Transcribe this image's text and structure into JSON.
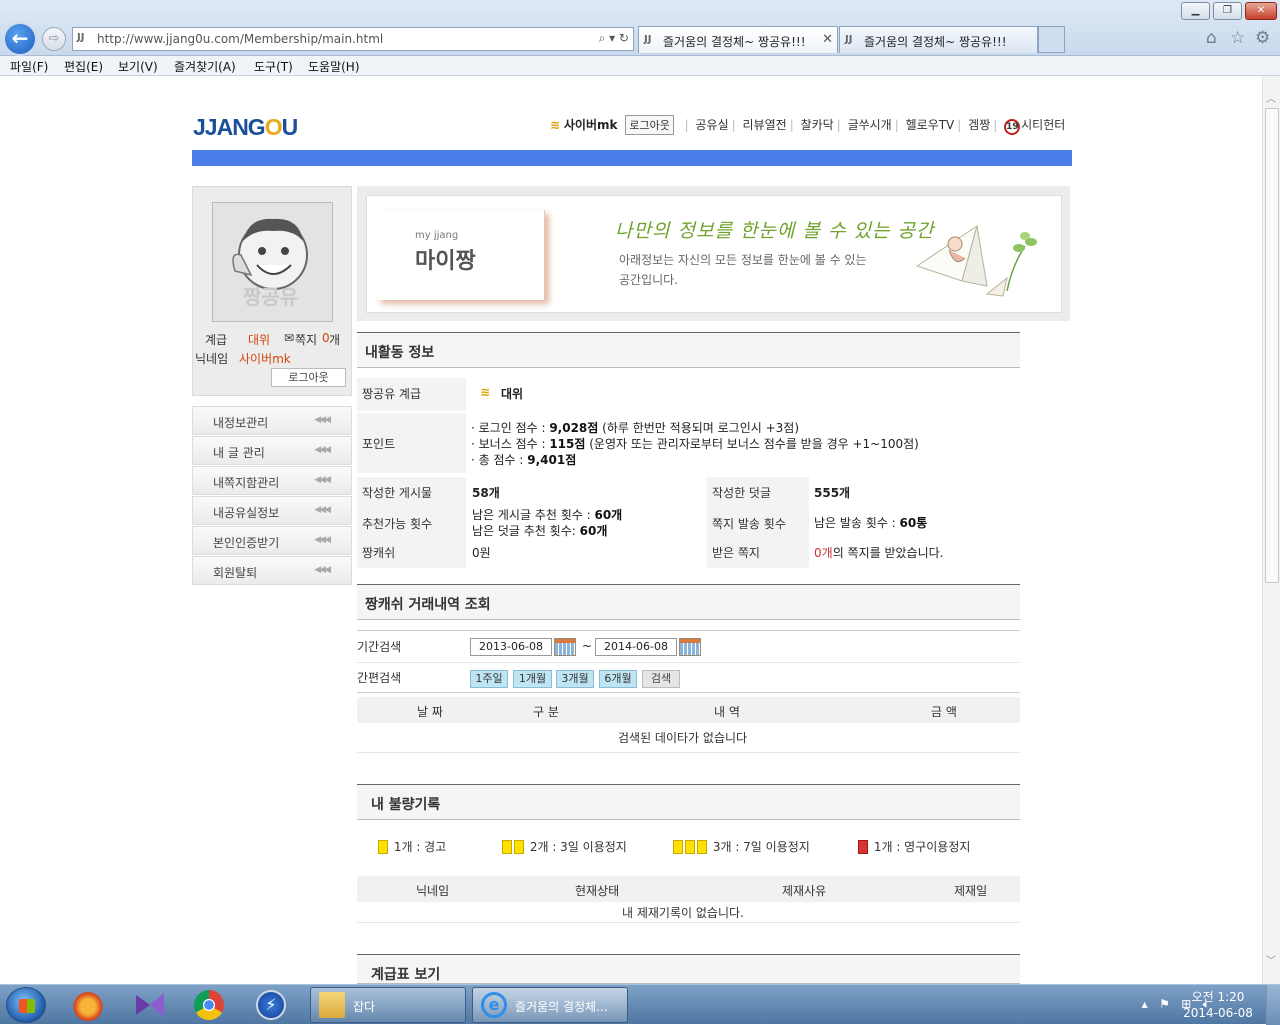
{
  "browser": {
    "address_url": "http://www.jjang0u.com/Membership/main.html",
    "tabs": [
      {
        "label": "즐거움의 결정체~ 짱공유!!!",
        "active": true
      },
      {
        "label": "즐거움의 결정체~ 짱공유!!!",
        "active": false
      }
    ],
    "menu": [
      "파일(F)",
      "편집(E)",
      "보기(V)",
      "즐겨찾기(A)",
      "도구(T)",
      "도움말(H)"
    ]
  },
  "header": {
    "logo_prefix": "JJANG",
    "logo_o": "O",
    "logo_suffix": "U",
    "username": "사이버mk",
    "logout": "로그아웃",
    "nav": [
      "공유실",
      "리뷰열전",
      "찰카닥",
      "글쑤시개",
      "헬로우TV",
      "겜짱"
    ],
    "age_badge": "19",
    "age_link": "시티헌터"
  },
  "profile": {
    "avatar_caption": "짱공유",
    "rank_label": "계급",
    "rank_value": "대위",
    "note_label": "쪽지",
    "note_count": "0",
    "note_unit": "개",
    "nickname_label": "닉네임",
    "nickname_value": "사이버mk",
    "logout": "로그아웃"
  },
  "sidebar": {
    "items": [
      {
        "label": "내정보관리"
      },
      {
        "label": "내 글 관리"
      },
      {
        "label": "내쪽지함관리"
      },
      {
        "label": "내공유실정보"
      },
      {
        "label": "본인인증받기"
      },
      {
        "label": "회원탈퇴"
      }
    ],
    "arrow": "◀◀◀"
  },
  "banner": {
    "small": "my jjang",
    "title": "마이짱",
    "slogan": "나만의 정보를 한눈에 볼 수 있는 공간",
    "desc": "아래정보는 자신의 모든 정보를 한눈에 볼 수 있는 공간입니다."
  },
  "activity": {
    "heading": "내활동 정보",
    "grade_label": "짱공유 계급",
    "grade_value": "대위",
    "points_label": "포인트",
    "login_prefix": "· 로그인 점수 : ",
    "login_score": "9,028점",
    "login_note": " (하루 한번만 적용되며 로그인시 +3점)",
    "bonus_prefix": "· 보너스 점수 : ",
    "bonus_score": "115점",
    "bonus_note": " (운영자 또는 관리자로부터 보너스 점수를 받을 경우 +1~100점)",
    "total_prefix": "· 총 점수 : ",
    "total_score": "9,401점",
    "posts_label": "작성한 게시물",
    "posts_value": "58개",
    "comments_label": "작성한 덧글",
    "comments_value": "555개",
    "recommend_label": "추천가능 횟수",
    "recommend_post_prefix": "남은 게시글 추천 횟수 : ",
    "recommend_post_value": "60개",
    "recommend_comment_prefix": "남은 덧글 추천 횟수: ",
    "recommend_comment_value": "60개",
    "msg_send_label": "쪽지 발송 횟수",
    "msg_send_prefix": "남은 발송 횟수 : ",
    "msg_send_value": "60통",
    "cash_label": "짱캐쉬",
    "cash_value": "0원",
    "received_label": "받은 쪽지",
    "received_count": "0개",
    "received_suffix": "의 쪽지를 받았습니다."
  },
  "cash_history": {
    "heading": "짱캐쉬 거래내역 조회",
    "period_label": "기간검색",
    "date_from": "2013-06-08",
    "date_sep": "~",
    "date_to": "2014-06-08",
    "quick_label": "간편검색",
    "quick_buttons": [
      "1주일",
      "1개월",
      "3개월",
      "6개월"
    ],
    "search_button": "검색",
    "columns": [
      "날 짜",
      "구 분",
      "내 역",
      "금 액"
    ],
    "empty": "검색된 데이타가 없습니다"
  },
  "penalty": {
    "heading": "내 불량기록",
    "legend": [
      {
        "count": 1,
        "color": "yellow",
        "label": "1개 : 경고"
      },
      {
        "count": 2,
        "color": "yellow",
        "label": "2개 : 3일 이용정지"
      },
      {
        "count": 3,
        "color": "yellow",
        "label": "3개 : 7일 이용정지"
      },
      {
        "count": 1,
        "color": "red",
        "label": "1개 : 영구이용정지"
      }
    ],
    "columns": [
      "닉네임",
      "현재상태",
      "제재사유",
      "제재일"
    ],
    "empty": "내 제재기록이 없습니다."
  },
  "grade_table": {
    "heading": "계급표 보기"
  },
  "taskbar": {
    "tasks": [
      {
        "label": "잡다"
      },
      {
        "label": "즐거움의 결정체..."
      }
    ],
    "clock_time": "오전 1:20",
    "clock_date": "2014-06-08"
  },
  "colors": {
    "brand_blue": "#4a7de8",
    "rank_red": "#c33333",
    "penalty_yellow": "#ffe100",
    "penalty_red": "#d93232"
  }
}
